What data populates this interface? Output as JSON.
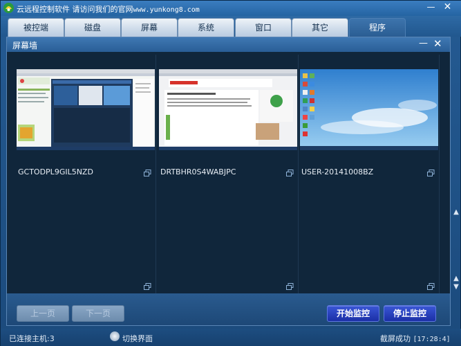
{
  "window": {
    "title": "云远程控制软件 请访问我们的官网",
    "url": "www.yunkong8.com",
    "min_label": "—",
    "close_label": "✕"
  },
  "tabs": [
    {
      "label": "被控端"
    },
    {
      "label": "磁盘"
    },
    {
      "label": "屏幕"
    },
    {
      "label": "系统"
    },
    {
      "label": "窗口"
    },
    {
      "label": "其它"
    },
    {
      "label": "程序"
    }
  ],
  "panel": {
    "title": "屏幕墙",
    "min_label": "—",
    "close_label": "✕"
  },
  "hosts": [
    {
      "name": "GCTODPL9GIL5NZD"
    },
    {
      "name": "DRTBHR0S4WABJPC"
    },
    {
      "name": "USER-20141008BZ"
    }
  ],
  "buttons": {
    "prev": "上一页",
    "next": "下一页",
    "start": "开始监控",
    "stop": "停止监控"
  },
  "status": {
    "connected": "已连接主机:3",
    "switch": "切换界面",
    "message": "截屏成功",
    "time": "[17:28:4]"
  },
  "colors": {
    "accent": "#2a5e96",
    "panel_bg": "#10263b",
    "primary_button": "#2a42c0"
  }
}
